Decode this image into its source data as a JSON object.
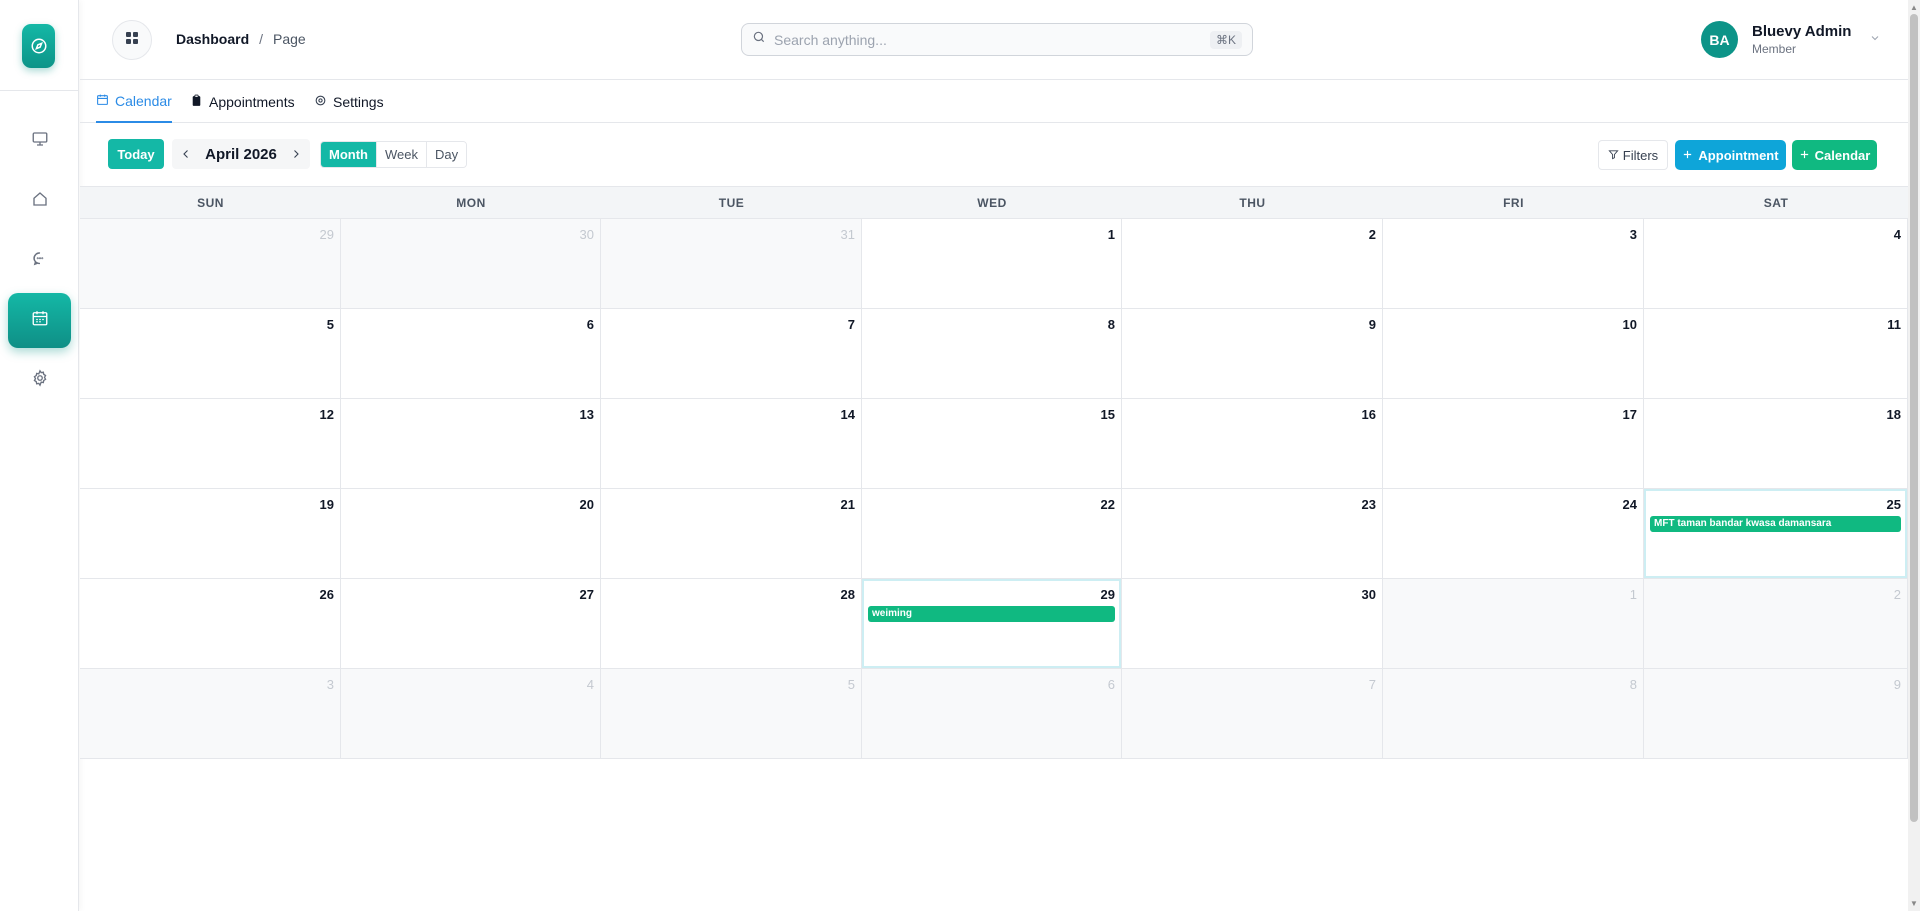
{
  "sidebar": {
    "items": [
      {
        "icon": "monitor-icon",
        "label": "Desktop"
      },
      {
        "icon": "home-icon",
        "label": "Home"
      },
      {
        "icon": "chat-icon",
        "label": "Messages"
      },
      {
        "icon": "calendar-icon",
        "label": "Calendar",
        "active": true
      },
      {
        "icon": "gear-icon",
        "label": "Settings"
      }
    ]
  },
  "header": {
    "breadcrumb": {
      "root": "Dashboard",
      "separator": "/",
      "current": "Page"
    },
    "search": {
      "placeholder": "Search anything...",
      "shortcut": "⌘K"
    },
    "user": {
      "initials": "BA",
      "name": "Bluevy Admin",
      "role": "Member"
    }
  },
  "tabs": [
    {
      "label": "Calendar",
      "active": true
    },
    {
      "label": "Appointments"
    },
    {
      "label": "Settings"
    }
  ],
  "toolbar": {
    "today_label": "Today",
    "month_label": "April 2026",
    "views": [
      "Month",
      "Week",
      "Day"
    ],
    "active_view": "Month",
    "filters_label": "Filters",
    "appointment_label": "Appointment",
    "calendar_label": "Calendar"
  },
  "calendar": {
    "weekdays": [
      "SUN",
      "MON",
      "TUE",
      "WED",
      "THU",
      "FRI",
      "SAT"
    ],
    "days": [
      {
        "n": "29",
        "other": true
      },
      {
        "n": "30",
        "other": true
      },
      {
        "n": "31",
        "other": true
      },
      {
        "n": "1"
      },
      {
        "n": "2"
      },
      {
        "n": "3"
      },
      {
        "n": "4"
      },
      {
        "n": "5"
      },
      {
        "n": "6"
      },
      {
        "n": "7"
      },
      {
        "n": "8"
      },
      {
        "n": "9"
      },
      {
        "n": "10"
      },
      {
        "n": "11"
      },
      {
        "n": "12"
      },
      {
        "n": "13"
      },
      {
        "n": "14"
      },
      {
        "n": "15"
      },
      {
        "n": "16"
      },
      {
        "n": "17"
      },
      {
        "n": "18"
      },
      {
        "n": "19"
      },
      {
        "n": "20"
      },
      {
        "n": "21"
      },
      {
        "n": "22"
      },
      {
        "n": "23"
      },
      {
        "n": "24"
      },
      {
        "n": "25",
        "highlight": true,
        "event": "MFT taman bandar kwasa damansara"
      },
      {
        "n": "26"
      },
      {
        "n": "27"
      },
      {
        "n": "28"
      },
      {
        "n": "29",
        "highlight": true,
        "event": "weiming"
      },
      {
        "n": "30"
      },
      {
        "n": "1",
        "other": true
      },
      {
        "n": "2",
        "other": true
      },
      {
        "n": "3",
        "other": true
      },
      {
        "n": "4",
        "other": true
      },
      {
        "n": "5",
        "other": true
      },
      {
        "n": "6",
        "other": true
      },
      {
        "n": "7",
        "other": true
      },
      {
        "n": "8",
        "other": true
      },
      {
        "n": "9",
        "other": true
      }
    ]
  },
  "colors": {
    "accent": "#14b8a6",
    "link": "#2b8be6",
    "appointment": "#0ea5d9",
    "event": "#10b981"
  }
}
